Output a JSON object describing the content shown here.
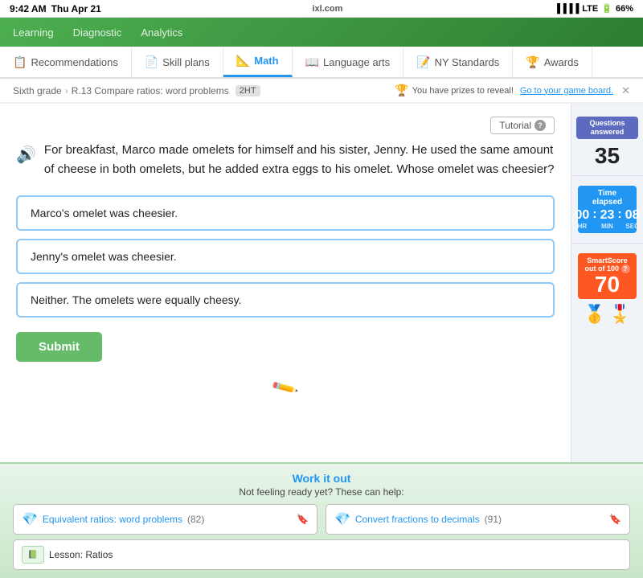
{
  "statusBar": {
    "time": "9:42 AM",
    "day": "Thu Apr 21",
    "domain": "ixl.com",
    "signal": "LTE",
    "battery": "66%"
  },
  "topNav": {
    "items": [
      {
        "label": "Learning",
        "active": false
      },
      {
        "label": "Diagnostic",
        "active": false
      },
      {
        "label": "Analytics",
        "active": false
      }
    ]
  },
  "tabs": [
    {
      "label": "Recommendations",
      "icon": "📋",
      "active": false
    },
    {
      "label": "Skill plans",
      "icon": "📄",
      "active": false
    },
    {
      "label": "Math",
      "icon": "📐",
      "active": true
    },
    {
      "label": "Language arts",
      "icon": "📖",
      "active": false
    },
    {
      "label": "NY Standards",
      "icon": "📝",
      "active": false
    },
    {
      "label": "Awards",
      "icon": "🏆",
      "active": false
    }
  ],
  "breadcrumb": {
    "grade": "Sixth grade",
    "skill": "R.13 Compare ratios: word problems",
    "tag": "2HT"
  },
  "prizeBanner": {
    "text": "You have prizes to reveal!",
    "linkText": "Go to your game board.",
    "show": true
  },
  "tutorial": {
    "label": "Tutorial"
  },
  "question": {
    "text": "For breakfast, Marco made omelets for himself and his sister, Jenny. He used the same amount of cheese in both omelets, but he added extra eggs to his omelet. Whose omelet was cheesier?"
  },
  "answers": [
    {
      "text": "Marco's omelet was cheesier.",
      "selected": false
    },
    {
      "text": "Jenny's omelet was cheesier.",
      "selected": false
    },
    {
      "text": "Neither. The omelets were equally cheesy.",
      "selected": false
    }
  ],
  "submitBtn": "Submit",
  "sidebar": {
    "questionsLabel": "Questions\nanswered",
    "questionsCount": "35",
    "timeLabel": "Time\nelapsed",
    "timeHr": "00",
    "timeMin": "23",
    "timeSec": "08",
    "smartScoreLabel": "SmartScore\nout of 100",
    "smartScoreValue": "70"
  },
  "workItOut": {
    "title": "Work it out",
    "subtitle": "Not feeling ready yet? These can help:",
    "resources": [
      {
        "label": "Equivalent ratios: word problems",
        "count": "(82)",
        "bookmark": true
      },
      {
        "label": "Convert fractions to decimals",
        "count": "(91)",
        "bookmark": true
      }
    ],
    "lesson": {
      "label": "Lesson: Ratios"
    }
  }
}
